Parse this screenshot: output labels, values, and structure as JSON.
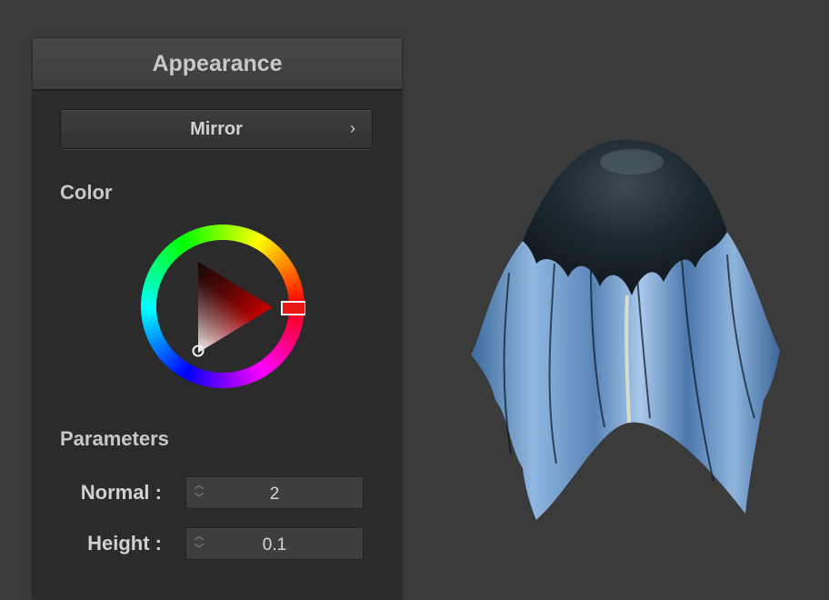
{
  "panel": {
    "title": "Appearance",
    "material_button": "Mirror",
    "color_section": "Color",
    "parameters_section": "Parameters",
    "parameters": [
      {
        "label": "Normal :",
        "value": "2"
      },
      {
        "label": "Height :",
        "value": "0.1"
      }
    ]
  },
  "color": {
    "selected_hue": "#ff0000",
    "icons": [
      "chevron-right-icon",
      "spin-up-icon",
      "spin-down-icon"
    ]
  }
}
